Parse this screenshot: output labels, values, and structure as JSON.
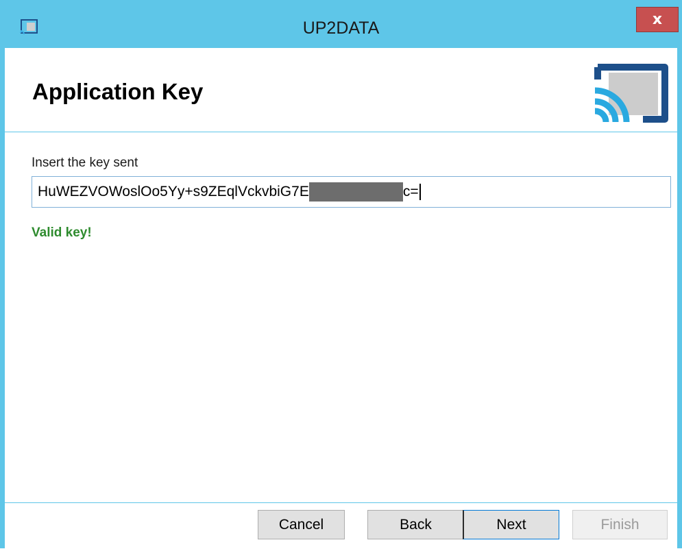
{
  "window": {
    "title": "UP2DATA",
    "close_label": "x"
  },
  "header": {
    "title": "Application Key",
    "logo_icon": "up2data-cast-icon",
    "accent_color": "#5ec6e8",
    "logo_color": "#1d4f8a"
  },
  "form": {
    "key_label": "Insert the key sent",
    "key_value_visible_start": "HuWEZVOWoslOo5Yy+s9ZEqlVckvbiG7E",
    "key_value_visible_end": "c=",
    "validation_message": "Valid key!",
    "validation_color": "#2e8b2e"
  },
  "footer": {
    "cancel_label": "Cancel",
    "back_label": "Back",
    "next_label": "Next",
    "finish_label": "Finish"
  }
}
